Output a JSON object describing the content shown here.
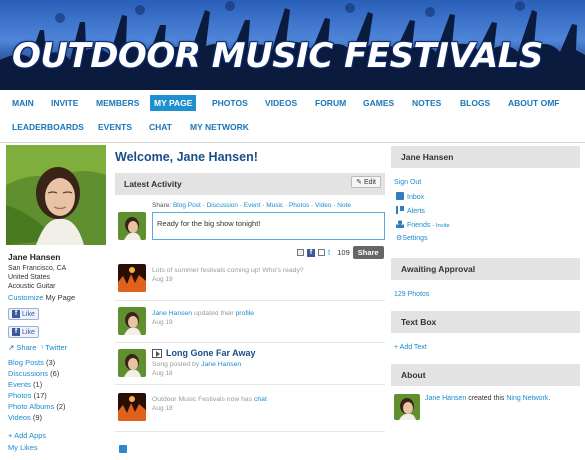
{
  "banner": {
    "title": "OUTDOOR MUSIC FESTIVALS"
  },
  "nav": {
    "items": [
      "MAIN",
      "INVITE",
      "MEMBERS",
      "MY PAGE",
      "PHOTOS",
      "VIDEOS",
      "FORUM",
      "GAMES",
      "NOTES",
      "BLOGS",
      "ABOUT OMF"
    ],
    "items2": [
      "LEADERBOARDS",
      "EVENTS",
      "CHAT",
      "MY NETWORK"
    ],
    "active": "MY PAGE"
  },
  "profile": {
    "name": "Jane Hansen",
    "location": "San Francisco, CA",
    "country": "United States",
    "instrument": "Acoustic Guitar",
    "customize": "Customize",
    "my_page": "My Page",
    "like1": "Like",
    "like2": "Like",
    "share": "Share",
    "twitter": "Twitter",
    "counts": [
      {
        "label": "Blog Posts",
        "count": "(3)"
      },
      {
        "label": "Discussions",
        "count": "(6)"
      },
      {
        "label": "Events",
        "count": "(1)"
      },
      {
        "label": "Photos",
        "count": "(17)"
      },
      {
        "label": "Photo Albums",
        "count": "(2)"
      },
      {
        "label": "Videos",
        "count": "(9)"
      }
    ],
    "add_apps": "Add Apps",
    "my_likes": "My Likes"
  },
  "main": {
    "welcome": "Welcome, Jane Hansen!",
    "activity_title": "Latest Activity",
    "edit": "Edit",
    "share_label": "Share:",
    "share_types": [
      "Blog Post",
      "Discussion",
      "Event",
      "Music",
      "Photos",
      "Video",
      "Note"
    ],
    "status_value": "Ready for the big show tonight!",
    "char_count": "109",
    "share_button": "Share",
    "feed": [
      {
        "text": "Lots of summer festivals coming up! Who's ready?",
        "date": "Aug 19"
      },
      {
        "actor": "Jane Hansen",
        "mid": " updated their ",
        "obj": "profile",
        "date": "Aug 19"
      },
      {
        "song": "Long Gone Far Away",
        "posted": "Song posted by ",
        "actor": "Jane Hansen",
        "date": "Aug 18"
      },
      {
        "actor": "Outdoor Music Festivals",
        "mid": " now has ",
        "obj": "chat",
        "date": "Aug 18"
      }
    ]
  },
  "sidebar": {
    "user_box": "Jane Hansen",
    "sign_out": "Sign Out",
    "inbox": "Inbox",
    "alerts": "Alerts",
    "friends": "Friends",
    "invite": "- Invite",
    "settings": "Settings",
    "awaiting": "Awaiting Approval",
    "photos_pending": "129 Photos",
    "text_box": "Text Box",
    "add_text": "+ Add Text",
    "about": "About",
    "about_actor": "Jane Hansen",
    "about_mid": " created this ",
    "about_obj": "Ning Network",
    "about_end": "."
  },
  "colors": {
    "link": "#1a8ccf",
    "nav": "#1976b8",
    "heading": "#1a4f86",
    "active_tab": "#1e90d0"
  }
}
